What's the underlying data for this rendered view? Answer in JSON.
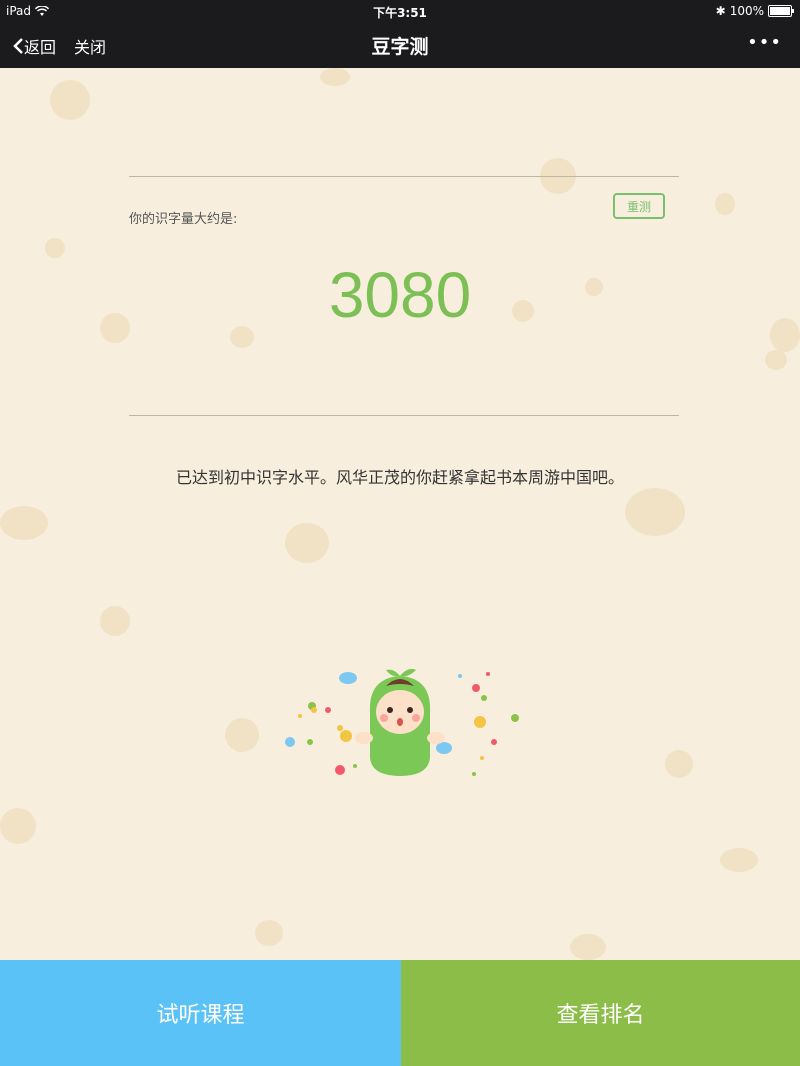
{
  "status_bar": {
    "device": "iPad",
    "time": "下午3:51",
    "battery": "100%"
  },
  "nav": {
    "back_label": "返回",
    "close_label": "关闭",
    "title": "豆字测",
    "more_label": "•••"
  },
  "result": {
    "label": "你的识字量大约是:",
    "retest_label": "重测",
    "score": "3080",
    "description": "已达到初中识字水平。风华正茂的你赶紧拿起书本周游中国吧。"
  },
  "buttons": {
    "trial_course": "试听课程",
    "view_ranking": "查看排名"
  },
  "colors": {
    "score": "#7cbf55",
    "trial_button": "#5ac2f7",
    "ranking_button": "#8bbd48",
    "background": "#f7eedd"
  }
}
